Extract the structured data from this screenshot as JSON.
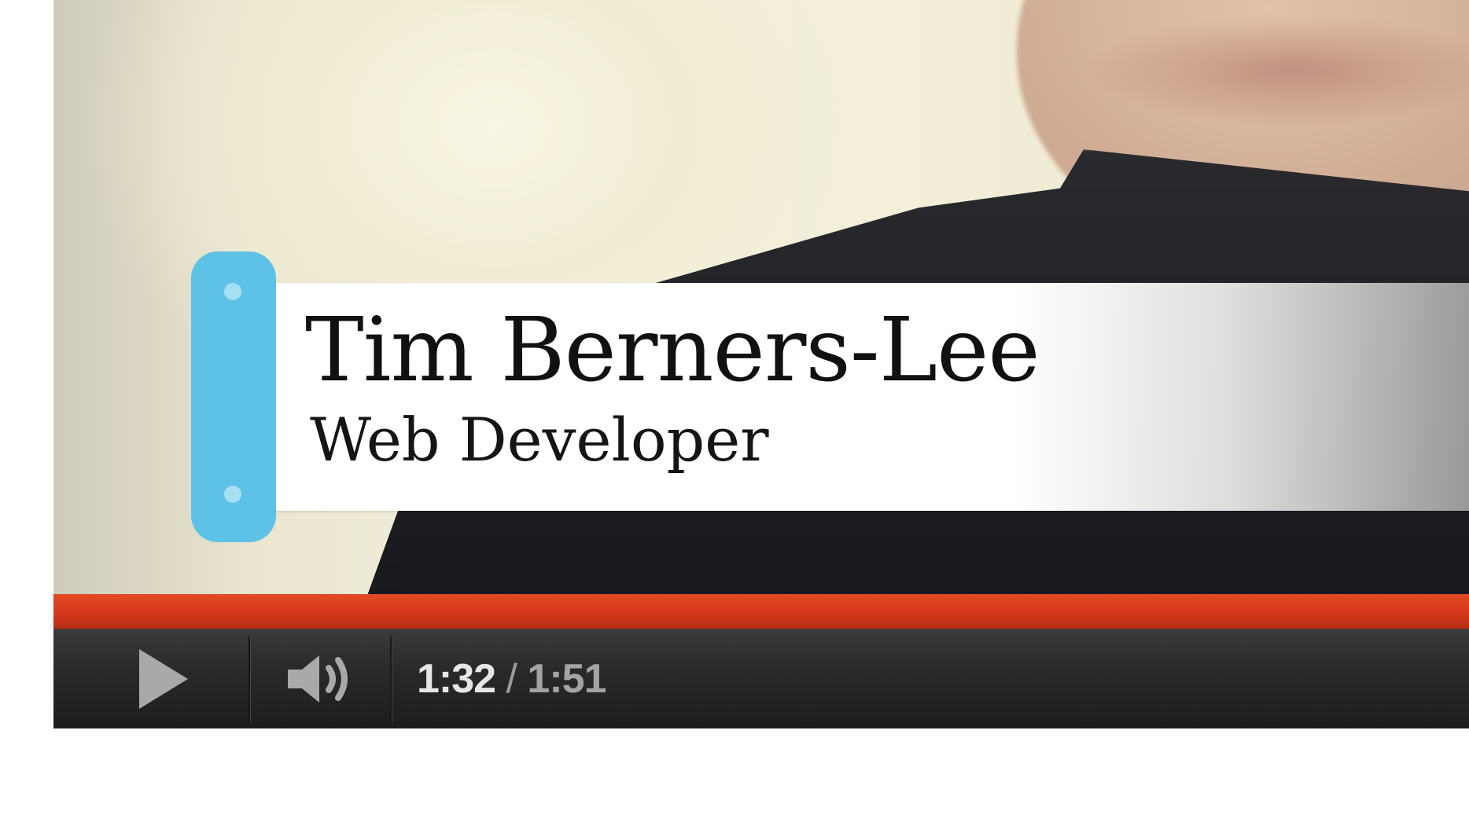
{
  "video": {
    "caption_name": "Tim Berners-Lee",
    "caption_role": "Web Developer"
  },
  "controls": {
    "play_icon": "play-icon",
    "volume_icon": "volume-icon",
    "time_current": "1:32",
    "time_separator": " / ",
    "time_total": "1:51",
    "progress_fraction": 1.0,
    "accent_color": "#5ec2e6",
    "progress_color": "#d5381a"
  }
}
